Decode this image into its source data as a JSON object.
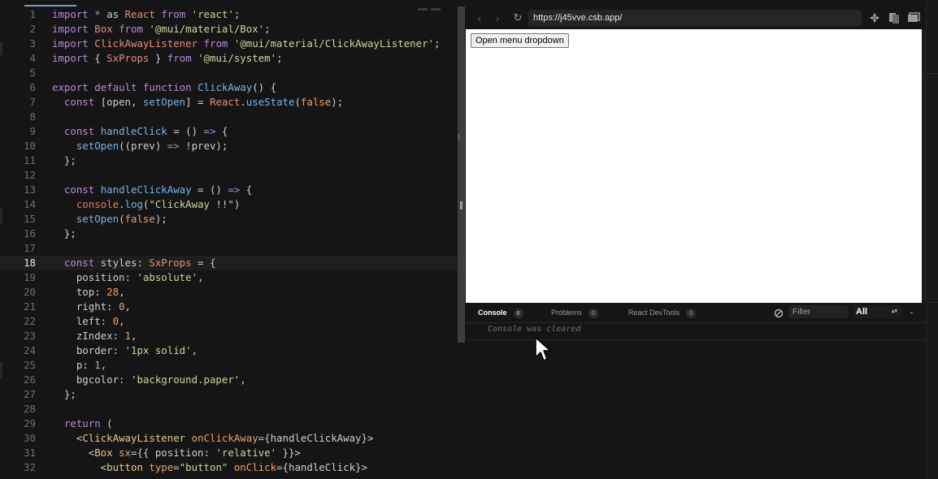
{
  "editor": {
    "active_line": 18,
    "lines": [
      {
        "n": "1",
        "t": [
          [
            "tk-kw",
            "import"
          ],
          [
            "",
            " "
          ],
          [
            "tk-op",
            "*"
          ],
          [
            "",
            " as "
          ],
          [
            "tk-cls",
            "React"
          ],
          [
            "",
            " "
          ],
          [
            "tk-kw",
            "from"
          ],
          [
            "",
            " "
          ],
          [
            "tk-str",
            "'react'"
          ],
          [
            "",
            ";"
          ]
        ]
      },
      {
        "n": "2",
        "t": [
          [
            "tk-kw",
            "import"
          ],
          [
            "",
            " "
          ],
          [
            "tk-cls",
            "Box"
          ],
          [
            "",
            " "
          ],
          [
            "tk-kw",
            "from"
          ],
          [
            "",
            " "
          ],
          [
            "tk-str",
            "'@mui/material/Box'"
          ],
          [
            "",
            ";"
          ]
        ]
      },
      {
        "n": "3",
        "t": [
          [
            "tk-kw",
            "import"
          ],
          [
            "",
            " "
          ],
          [
            "tk-cls",
            "ClickAwayListener"
          ],
          [
            "",
            " "
          ],
          [
            "tk-kw",
            "from"
          ],
          [
            "",
            " "
          ],
          [
            "tk-str",
            "'@mui/material/ClickAwayListener'"
          ],
          [
            "",
            ";"
          ]
        ]
      },
      {
        "n": "4",
        "t": [
          [
            "tk-kw",
            "import"
          ],
          [
            "",
            " { "
          ],
          [
            "tk-cls",
            "SxProps"
          ],
          [
            "",
            " } "
          ],
          [
            "tk-kw",
            "from"
          ],
          [
            "",
            " "
          ],
          [
            "tk-str",
            "'@mui/system'"
          ],
          [
            "",
            ";"
          ]
        ]
      },
      {
        "n": "5",
        "t": []
      },
      {
        "n": "6",
        "t": [
          [
            "tk-kw",
            "export"
          ],
          [
            "",
            " "
          ],
          [
            "tk-kw",
            "default"
          ],
          [
            "",
            " "
          ],
          [
            "tk-kw",
            "function"
          ],
          [
            "",
            " "
          ],
          [
            "tk-fn",
            "ClickAway"
          ],
          [
            "",
            "() {"
          ]
        ]
      },
      {
        "n": "7",
        "t": [
          [
            "",
            "  "
          ],
          [
            "tk-kw",
            "const"
          ],
          [
            "",
            " [open, "
          ],
          [
            "tk-fn",
            "setOpen"
          ],
          [
            "",
            "] = "
          ],
          [
            "tk-cls",
            "React"
          ],
          [
            "",
            "."
          ],
          [
            "tk-fn",
            "useState"
          ],
          [
            "",
            "("
          ],
          [
            "tk-bool",
            "false"
          ],
          [
            "",
            ");"
          ]
        ]
      },
      {
        "n": "8",
        "t": []
      },
      {
        "n": "9",
        "t": [
          [
            "",
            "  "
          ],
          [
            "tk-kw",
            "const"
          ],
          [
            "",
            " "
          ],
          [
            "tk-fn",
            "handleClick"
          ],
          [
            "",
            " = () "
          ],
          [
            "tk-kw",
            "=>"
          ],
          [
            "",
            " {"
          ]
        ]
      },
      {
        "n": "10",
        "t": [
          [
            "",
            "    "
          ],
          [
            "tk-fn",
            "setOpen"
          ],
          [
            "",
            "((prev) "
          ],
          [
            "tk-kw",
            "=>"
          ],
          [
            "",
            " !prev);"
          ]
        ]
      },
      {
        "n": "11",
        "t": [
          [
            "",
            "  };"
          ]
        ]
      },
      {
        "n": "12",
        "t": []
      },
      {
        "n": "13",
        "t": [
          [
            "",
            "  "
          ],
          [
            "tk-kw",
            "const"
          ],
          [
            "",
            " "
          ],
          [
            "tk-fn",
            "handleClickAway"
          ],
          [
            "",
            " = () "
          ],
          [
            "tk-kw",
            "=>"
          ],
          [
            "",
            " {"
          ]
        ]
      },
      {
        "n": "14",
        "t": [
          [
            "",
            "    "
          ],
          [
            "tk-con",
            "console"
          ],
          [
            "",
            "."
          ],
          [
            "tk-fn",
            "log"
          ],
          [
            "",
            "("
          ],
          [
            "tk-str",
            "\"ClickAway !!\""
          ],
          [
            "",
            ")"
          ]
        ]
      },
      {
        "n": "15",
        "t": [
          [
            "",
            "    "
          ],
          [
            "tk-fn",
            "setOpen"
          ],
          [
            "",
            "("
          ],
          [
            "tk-bool",
            "false"
          ],
          [
            "",
            ");"
          ]
        ]
      },
      {
        "n": "16",
        "t": [
          [
            "",
            "  };"
          ]
        ]
      },
      {
        "n": "17",
        "t": []
      },
      {
        "n": "18",
        "t": [
          [
            "",
            "  "
          ],
          [
            "tk-kw",
            "const"
          ],
          [
            "",
            " styles: "
          ],
          [
            "tk-cls",
            "SxProps"
          ],
          [
            "",
            " = {"
          ]
        ]
      },
      {
        "n": "19",
        "t": [
          [
            "",
            "    position: "
          ],
          [
            "tk-str",
            "'absolute'"
          ],
          [
            "",
            ","
          ]
        ]
      },
      {
        "n": "20",
        "t": [
          [
            "",
            "    top: "
          ],
          [
            "tk-num",
            "28"
          ],
          [
            "",
            ","
          ]
        ]
      },
      {
        "n": "21",
        "t": [
          [
            "",
            "    right: "
          ],
          [
            "tk-num",
            "0"
          ],
          [
            "",
            ","
          ]
        ]
      },
      {
        "n": "22",
        "t": [
          [
            "",
            "    left: "
          ],
          [
            "tk-num",
            "0"
          ],
          [
            "",
            ","
          ]
        ]
      },
      {
        "n": "23",
        "t": [
          [
            "",
            "    zIndex: "
          ],
          [
            "tk-num",
            "1"
          ],
          [
            "",
            ","
          ]
        ]
      },
      {
        "n": "24",
        "t": [
          [
            "",
            "    border: "
          ],
          [
            "tk-str",
            "'1px solid'"
          ],
          [
            "",
            ","
          ]
        ]
      },
      {
        "n": "25",
        "t": [
          [
            "",
            "    p: "
          ],
          [
            "tk-num",
            "1"
          ],
          [
            "",
            ","
          ]
        ]
      },
      {
        "n": "26",
        "t": [
          [
            "",
            "    bgcolor: "
          ],
          [
            "tk-str",
            "'background.paper'"
          ],
          [
            "",
            ","
          ]
        ]
      },
      {
        "n": "27",
        "t": [
          [
            "",
            "  };"
          ]
        ]
      },
      {
        "n": "28",
        "t": []
      },
      {
        "n": "29",
        "t": [
          [
            "",
            "  "
          ],
          [
            "tk-kw",
            "return"
          ],
          [
            "",
            " ("
          ]
        ]
      },
      {
        "n": "30",
        "t": [
          [
            "",
            "    <"
          ],
          [
            "tk-tag",
            "ClickAwayListener"
          ],
          [
            "",
            " "
          ],
          [
            "tk-attr",
            "onClickAway"
          ],
          [
            "",
            "={handleClickAway}>"
          ]
        ]
      },
      {
        "n": "31",
        "t": [
          [
            "",
            "      <"
          ],
          [
            "tk-tag",
            "Box"
          ],
          [
            "",
            " "
          ],
          [
            "tk-attr",
            "sx"
          ],
          [
            "",
            "={{ position: "
          ],
          [
            "tk-str",
            "'relative'"
          ],
          [
            "",
            " }}>"
          ]
        ]
      },
      {
        "n": "32",
        "t": [
          [
            "",
            "        <"
          ],
          [
            "tk-tag",
            "button"
          ],
          [
            "",
            " "
          ],
          [
            "tk-attr",
            "type"
          ],
          [
            "",
            "="
          ],
          [
            "tk-str",
            "\"button\""
          ],
          [
            "",
            " "
          ],
          [
            "tk-attr",
            "onClick"
          ],
          [
            "",
            "={handleClick}>"
          ]
        ]
      }
    ]
  },
  "browser": {
    "url": "https://j45vve.csb.app/",
    "page_button_label": "Open menu dropdown",
    "icons": {
      "back": "back-arrow-icon",
      "forward": "forward-arrow-icon",
      "reload": "reload-icon"
    }
  },
  "devtools": {
    "tabs": [
      {
        "label": "Console",
        "count": "0"
      },
      {
        "label": "Problems",
        "count": "0"
      },
      {
        "label": "React DevTools",
        "count": "0"
      }
    ],
    "filter_placeholder": "Filter",
    "level": "All",
    "console_message": "Console was cleared"
  }
}
